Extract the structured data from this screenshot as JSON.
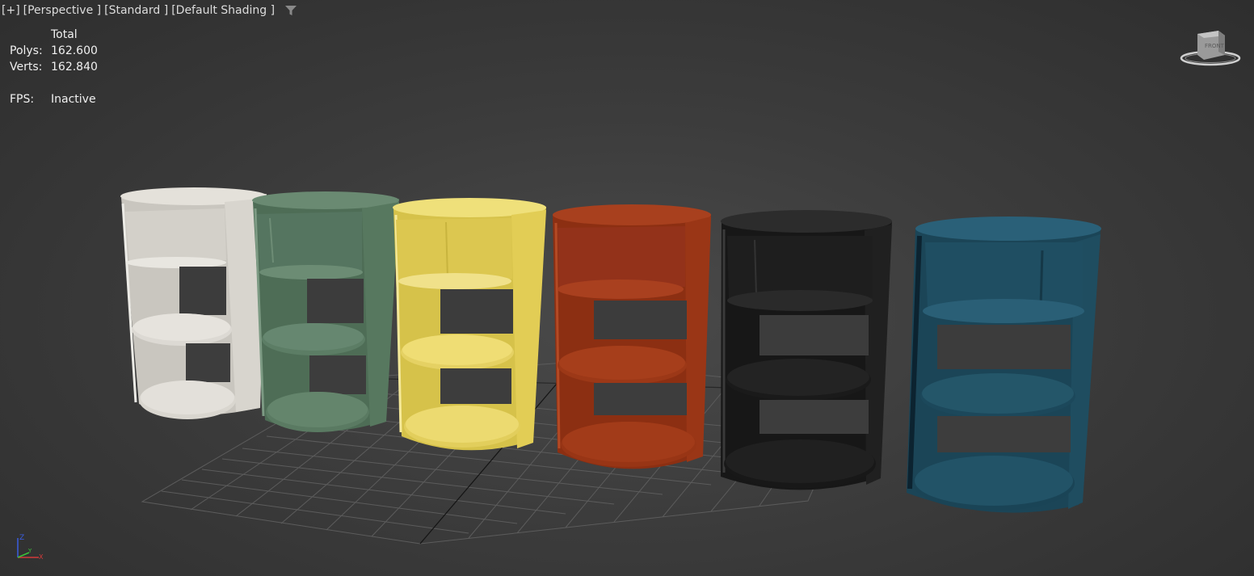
{
  "viewport": {
    "labels": {
      "plus": "[+]",
      "view": "[Perspective ]",
      "mode": "[Standard ]",
      "shading": "[Default Shading ]"
    },
    "filter_icon": "filter-icon"
  },
  "stats": {
    "header": "Total",
    "polys_label": "Polys:",
    "polys_value": "162.600",
    "verts_label": "Verts:",
    "verts_value": "162.840",
    "fps_label": "FPS:",
    "fps_value": "Inactive"
  },
  "viewcube": {
    "face_label": "FRONT",
    "icon": "viewcube-icon"
  },
  "axis_tripod": {
    "z": "Z",
    "x": "X",
    "y": "Y"
  },
  "objects": [
    {
      "name": "white-shelf-unit",
      "color": "#d6d3cc"
    },
    {
      "name": "green-shelf-unit",
      "color": "#5b7b63"
    },
    {
      "name": "yellow-shelf-unit",
      "color": "#e3cf55"
    },
    {
      "name": "red-shelf-unit",
      "color": "#9a3314"
    },
    {
      "name": "black-shelf-unit",
      "color": "#1c1c1c"
    },
    {
      "name": "teal-shelf-unit",
      "color": "#1e4e62"
    }
  ],
  "colors": {
    "grid": "#5e5e5e",
    "axis_line": "#111111"
  }
}
